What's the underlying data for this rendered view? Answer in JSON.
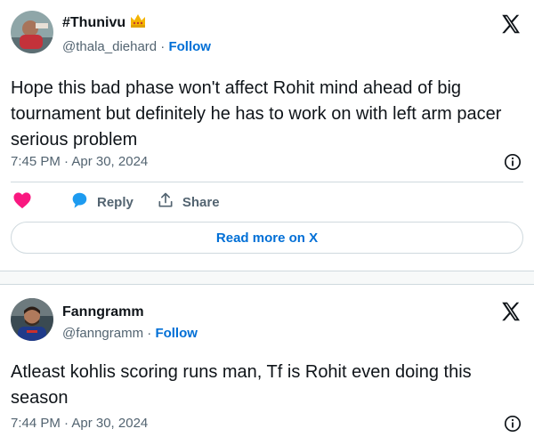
{
  "tweets": [
    {
      "display_name": "#Thunivu",
      "handle": "@thala_diehard",
      "separator": " · ",
      "follow_label": "Follow",
      "text": "Hope this bad phase won't affect Rohit mind ahead of big tournament but definitely he has to work on with left arm pacer serious problem",
      "time": "7:45 PM · Apr 30, 2024",
      "like_icon": "heart-icon",
      "reply_label": "Reply",
      "share_label": "Share",
      "read_more_label": "Read more on X"
    },
    {
      "display_name": "Fanngramm",
      "handle": "@fanngramm",
      "separator": " · ",
      "follow_label": "Follow",
      "text": "Atleast kohlis scoring runs man, Tf is Rohit even doing this season",
      "time": "7:44 PM · Apr 30, 2024"
    }
  ],
  "colors": {
    "accent": "#006fd6",
    "like": "#f91880",
    "reply": "#1d9bf0",
    "secondary_text": "#536471",
    "border": "#cfd9de"
  }
}
